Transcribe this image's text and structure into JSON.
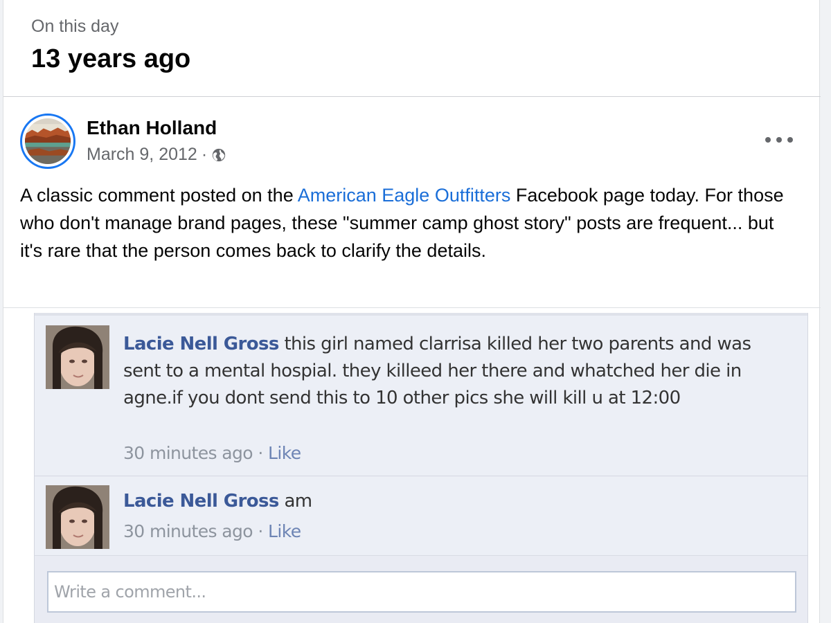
{
  "header": {
    "subtitle": "On this day",
    "title": "13 years ago"
  },
  "post": {
    "author": "Ethan Holland",
    "date": "March 9, 2012",
    "separator": "·",
    "privacy_icon": "globe-icon",
    "text_before_link": "A classic comment posted on the ",
    "link_text": "American Eagle Outfitters",
    "text_after_link": " Facebook page today.  For those who don't manage brand pages, these \"summer camp ghost story\" posts are frequent... but it's rare that the person comes back to clarify the details.",
    "more_icon": "more-options-icon"
  },
  "embedded_screenshot": {
    "comments": [
      {
        "name": "Lacie Nell Gross",
        "text": " this girl named clarrisa killed her two parents and was sent to a mental hospial. they killeed her there and whatched her die in agne.if you dont send this to 10 other pics she will kill u at 12:00",
        "time": "30 minutes ago",
        "dot": " · ",
        "like": "Like"
      },
      {
        "name": "Lacie Nell Gross",
        "text": " am",
        "time": "30 minutes ago",
        "dot": " · ",
        "like": "Like"
      }
    ],
    "write_placeholder": "Write a comment..."
  },
  "colors": {
    "link": "#1a6ed8",
    "avatar_ring": "#1877f2",
    "old_fb_name": "#3b5998"
  }
}
